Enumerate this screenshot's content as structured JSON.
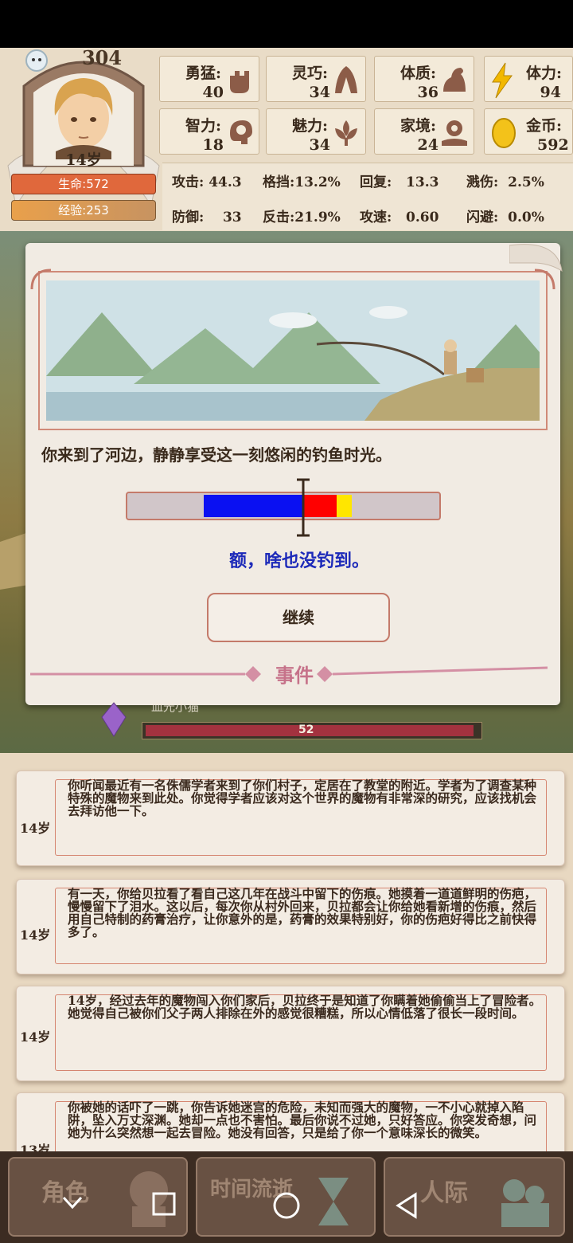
{
  "player": {
    "score": "304",
    "age": "14岁",
    "hp_label": "生命:572",
    "exp_label": "经验:253"
  },
  "stats": [
    {
      "label": "勇猛:",
      "value": "40",
      "icon": "fist-icon"
    },
    {
      "label": "灵巧:",
      "value": "34",
      "icon": "cloak-icon"
    },
    {
      "label": "体质:",
      "value": "36",
      "icon": "muscle-icon"
    },
    {
      "label": "体力:",
      "value": "94",
      "icon": "lightning-icon"
    },
    {
      "label": "智力:",
      "value": "18",
      "icon": "brain-icon"
    },
    {
      "label": "魅力:",
      "value": "34",
      "icon": "flower-icon"
    },
    {
      "label": "家境:",
      "value": "24",
      "icon": "coin-hand-icon"
    },
    {
      "label": "金币:",
      "value": "592",
      "icon": "gold-coin-icon"
    }
  ],
  "combat": {
    "attack": "攻击: 44.3",
    "block": "格挡:13.2%",
    "regen": "回复:   13.3",
    "splash": "溅伤:  2.5%",
    "defense": "防御:    33",
    "counter": "反击:21.9%",
    "speed": "攻速:   0.60",
    "dodge": "闪避:  0.0%"
  },
  "event": {
    "story": "你来到了河边，静静享受这一刻悠闲的钓鱼时光。",
    "result": "额，啥也没钓到。",
    "continue_label": "继续",
    "section_title": "事件"
  },
  "meter": {
    "zones": [
      {
        "color": "#0a10f2",
        "from": 0.245,
        "to": 0.565
      },
      {
        "color": "#ff0000",
        "from": 0.565,
        "to": 0.67
      },
      {
        "color": "#ffe600",
        "from": 0.67,
        "to": 0.72
      }
    ],
    "marker_position": 0.565
  },
  "monster": {
    "name": "血光小猫",
    "hp": "52"
  },
  "log": [
    {
      "age": "14岁",
      "text": "你听闻最近有一名侏儒学者来到了你们村子，定居在了教堂的附近。学者为了调查某种特殊的魔物来到此处。你觉得学者应该对这个世界的魔物有非常深的研究，应该找机会去拜访他一下。"
    },
    {
      "age": "14岁",
      "text": "有一天，你给贝拉看了看自己这几年在战斗中留下的伤痕。她摸着一道道鲜明的伤疤，慢慢留下了泪水。这以后，每次你从村外回来，贝拉都会让你给她看新增的伤痕，然后用自己特制的药膏治疗，让你意外的是，药膏的效果特别好，你的伤疤好得比之前快得多了。"
    },
    {
      "age": "14岁",
      "text": "14岁，经过去年的魔物闯入你们家后，贝拉终于是知道了你瞒着她偷偷当上了冒险者。她觉得自己被你们父子两人排除在外的感觉很糟糕，所以心情低落了很长一段时间。"
    },
    {
      "age": "13岁",
      "text": "你被她的话吓了一跳，你告诉她迷宫的危险，未知而强大的魔物，一不小心就掉入陷阱，坠入万丈深渊。她却一点也不害怕。最后你说不过她，只好答应。你突发奇想，问她为什么突然想一起去冒险。她没有回答，只是给了你一个意味深长的微笑。"
    }
  ],
  "nav": {
    "character": "角色",
    "time": "时间流逝",
    "social": "人际"
  }
}
